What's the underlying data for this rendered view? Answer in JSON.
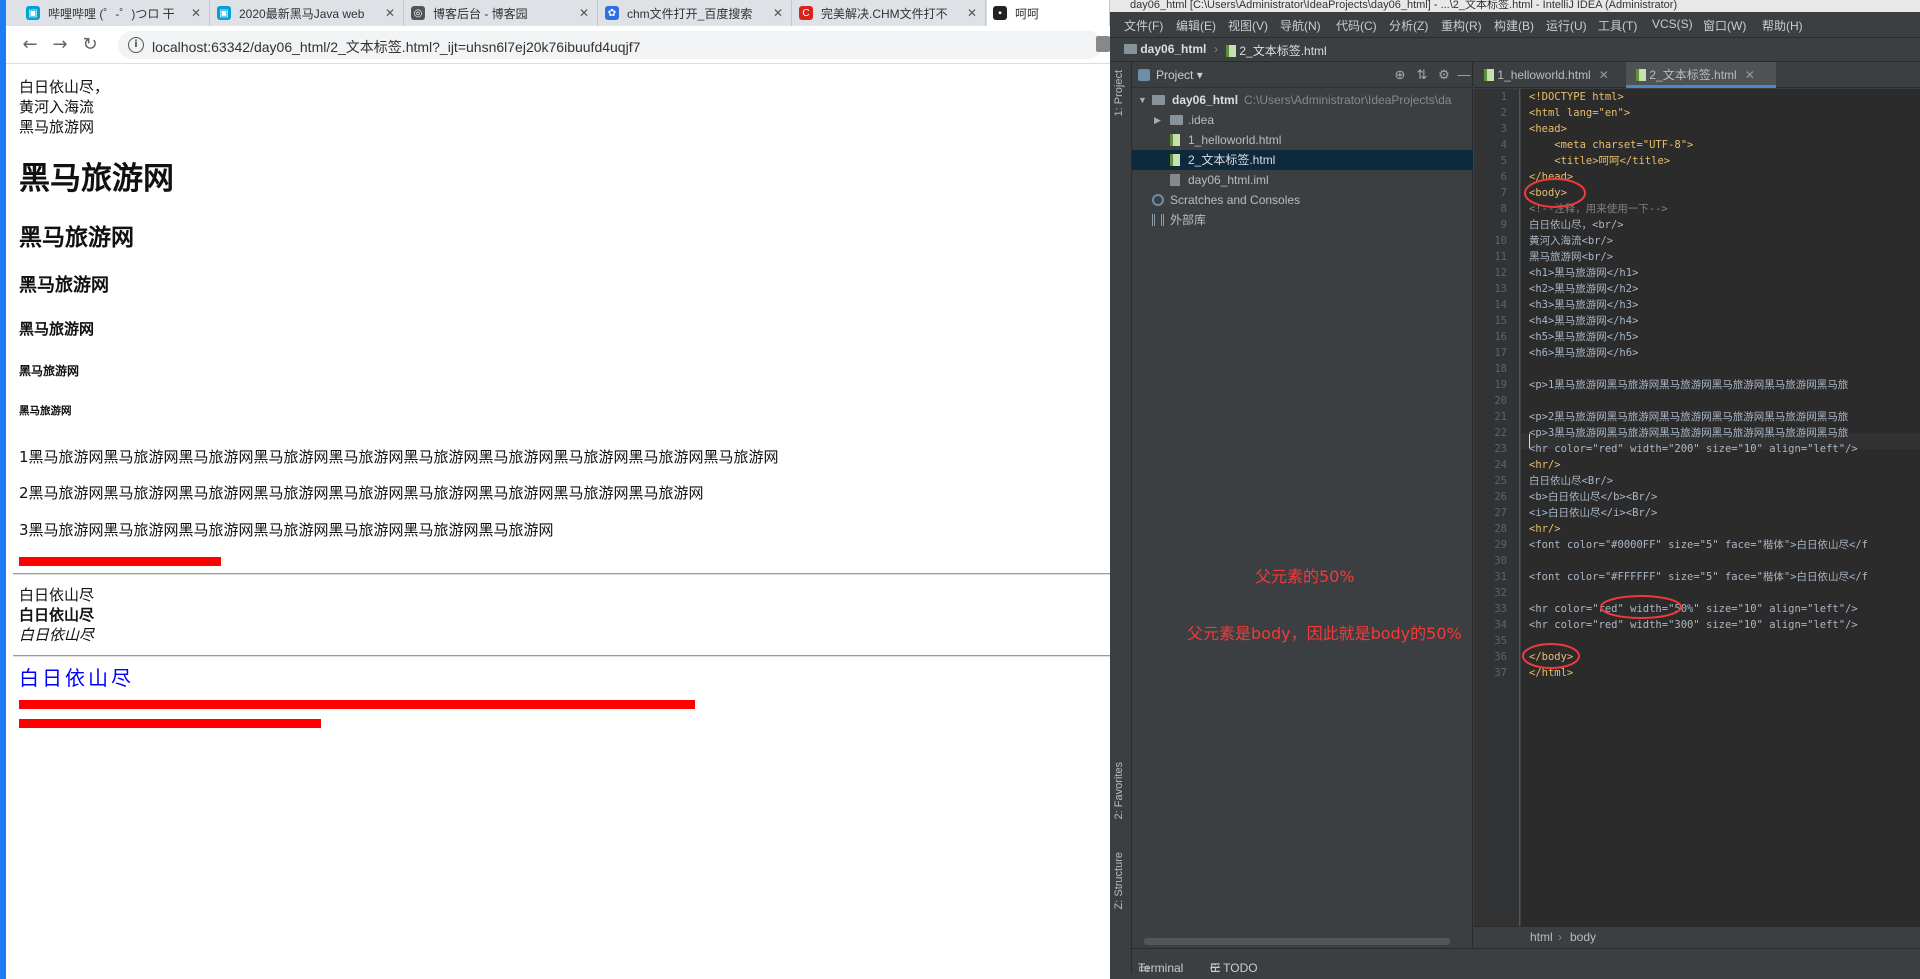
{
  "browser": {
    "tabs": [
      {
        "title": "哔哩哔哩 (゜-゜)つロ 干",
        "close": "✕",
        "favicon_color": "#00a1d6"
      },
      {
        "title": "2020最新黑马Java web",
        "close": "✕",
        "favicon_color": "#00a1d6"
      },
      {
        "title": "博客后台 - 博客园",
        "close": "✕",
        "favicon_color": "#555555"
      },
      {
        "title": "chm文件打开_百度搜索",
        "close": "✕",
        "favicon_color": "#2f6fe4"
      },
      {
        "title": "完美解决.CHM文件打不",
        "close": "✕",
        "favicon_color": "#d9241c"
      },
      {
        "title": "呵呵",
        "close": "",
        "favicon_color": "#222222"
      }
    ],
    "nav": {
      "back": "←",
      "forward": "→",
      "reload": "↻"
    },
    "url": "localhost:63342/day06_html/2_文本标签.html?_ijt=uhsn6l7ej20k76ibuufd4uqjf7",
    "page": {
      "lines": [
        "白日依山尽，",
        "黄河入海流",
        "黑马旅游网"
      ],
      "headings": [
        "黑马旅游网",
        "黑马旅游网",
        "黑马旅游网",
        "黑马旅游网",
        "黑马旅游网",
        "黑马旅游网"
      ],
      "paragraphs": [
        "1黑马旅游网黑马旅游网黑马旅游网黑马旅游网黑马旅游网黑马旅游网黑马旅游网黑马旅游网黑马旅游网黑马旅游网",
        "2黑马旅游网黑马旅游网黑马旅游网黑马旅游网黑马旅游网黑马旅游网黑马旅游网黑马旅游网黑马旅游网",
        "3黑马旅游网黑马旅游网黑马旅游网黑马旅游网黑马旅游网黑马旅游网黑马旅游网"
      ],
      "plain_text": "白日依山尽",
      "bold_text": "白日依山尽",
      "italic_text": "白日依山尽",
      "font_text": "白日依山尽",
      "font_color": "#0000FF",
      "hr_color": "#ff0000"
    }
  },
  "ide": {
    "title": "day06_html [C:\\Users\\Administrator\\IdeaProjects\\day06_html] - ...\\2_文本标签.html - IntelliJ IDEA (Administrator)",
    "menu": [
      "文件(F)",
      "编辑(E)",
      "视图(V)",
      "导航(N)",
      "代码(C)",
      "分析(Z)",
      "重构(R)",
      "构建(B)",
      "运行(U)",
      "工具(T)",
      "VCS(S)",
      "窗口(W)",
      "帮助(H)"
    ],
    "breadcrumb": {
      "project": "day06_html",
      "file": "2_文本标签.html"
    },
    "left_strip": {
      "project": "1: Project",
      "favorites": "2: Favorites",
      "structure": "Z: Structure"
    },
    "project_panel": {
      "title": "Project",
      "tree": [
        {
          "label": "day06_html",
          "path": "C:\\Users\\Administrator\\IdeaProjects\\da"
        },
        {
          "label": ".idea"
        },
        {
          "label": "1_helloworld.html"
        },
        {
          "label": "2_文本标签.html"
        },
        {
          "label": "day06_html.iml"
        },
        {
          "label": "Scratches and Consoles"
        },
        {
          "label": "外部库"
        }
      ]
    },
    "editor_tabs": [
      {
        "label": "1_helloworld.html",
        "close": "✕"
      },
      {
        "label": "2_文本标签.html",
        "close": "✕"
      }
    ],
    "line_numbers": [
      "1",
      "2",
      "3",
      "4",
      "5",
      "6",
      "7",
      "8",
      "9",
      "10",
      "11",
      "12",
      "13",
      "14",
      "15",
      "16",
      "17",
      "18",
      "19",
      "20",
      "21",
      "22",
      "23",
      "24",
      "25",
      "26",
      "27",
      "28",
      "29",
      "30",
      "31",
      "32",
      "33",
      "34",
      "35",
      "36",
      "37"
    ],
    "code": {
      "l1": "<!DOCTYPE html>",
      "l2": "<html lang=\"en\">",
      "l3": "<head>",
      "l4": "    <meta charset=\"UTF-8\">",
      "l5": "    <title>呵呵</title>",
      "l6": "</head>",
      "l7": "<body>",
      "l8": "<!--注释，用来使用一下-->",
      "l9": "白日依山尽，<br/>",
      "l10": "黄河入海流<br/>",
      "l11": "黑马旅游网<br/>",
      "l12": "<h1>黑马旅游网</h1>",
      "l13": "<h2>黑马旅游网</h2>",
      "l14": "<h3>黑马旅游网</h3>",
      "l15": "<h4>黑马旅游网</h4>",
      "l16": "<h5>黑马旅游网</h5>",
      "l17": "<h6>黑马旅游网</h6>",
      "l19": "<p>1黑马旅游网黑马旅游网黑马旅游网黑马旅游网黑马旅游网黑马旅",
      "l21": "<p>2黑马旅游网黑马旅游网黑马旅游网黑马旅游网黑马旅游网黑马旅",
      "l22": "<p>3黑马旅游网黑马旅游网黑马旅游网黑马旅游网黑马旅游网黑马旅",
      "l23": "<hr color=\"red\" width=\"200\" size=\"10\" align=\"left\"/>",
      "l24": "<hr/>",
      "l25": "白日依山尽<Br/>",
      "l26": "<b>白日依山尽</b><Br/>",
      "l27": "<i>白日依山尽</i><Br/>",
      "l28": "<hr/>",
      "l29": "<font color=\"#0000FF\" size=\"5\" face=\"楷体\">白日依山尽</f",
      "l31": "<font color=\"#FFFFFF\" size=\"5\" face=\"楷体\">白日依山尽</f",
      "l33": "<hr color=\"red\" width=\"50%\" size=\"10\" align=\"left\"/>",
      "l34": "<hr color=\"red\" width=\"300\" size=\"10\" align=\"left\"/>",
      "l36": "</body>",
      "l37": "</html>"
    },
    "annotations": {
      "a1": "父元素的50%",
      "a2": "父元素是body，因此就是body的50%"
    },
    "editor_breadcrumb": [
      "html",
      "body"
    ],
    "bottom_tools": {
      "terminal": "Terminal",
      "todo": "6: TODO"
    }
  }
}
